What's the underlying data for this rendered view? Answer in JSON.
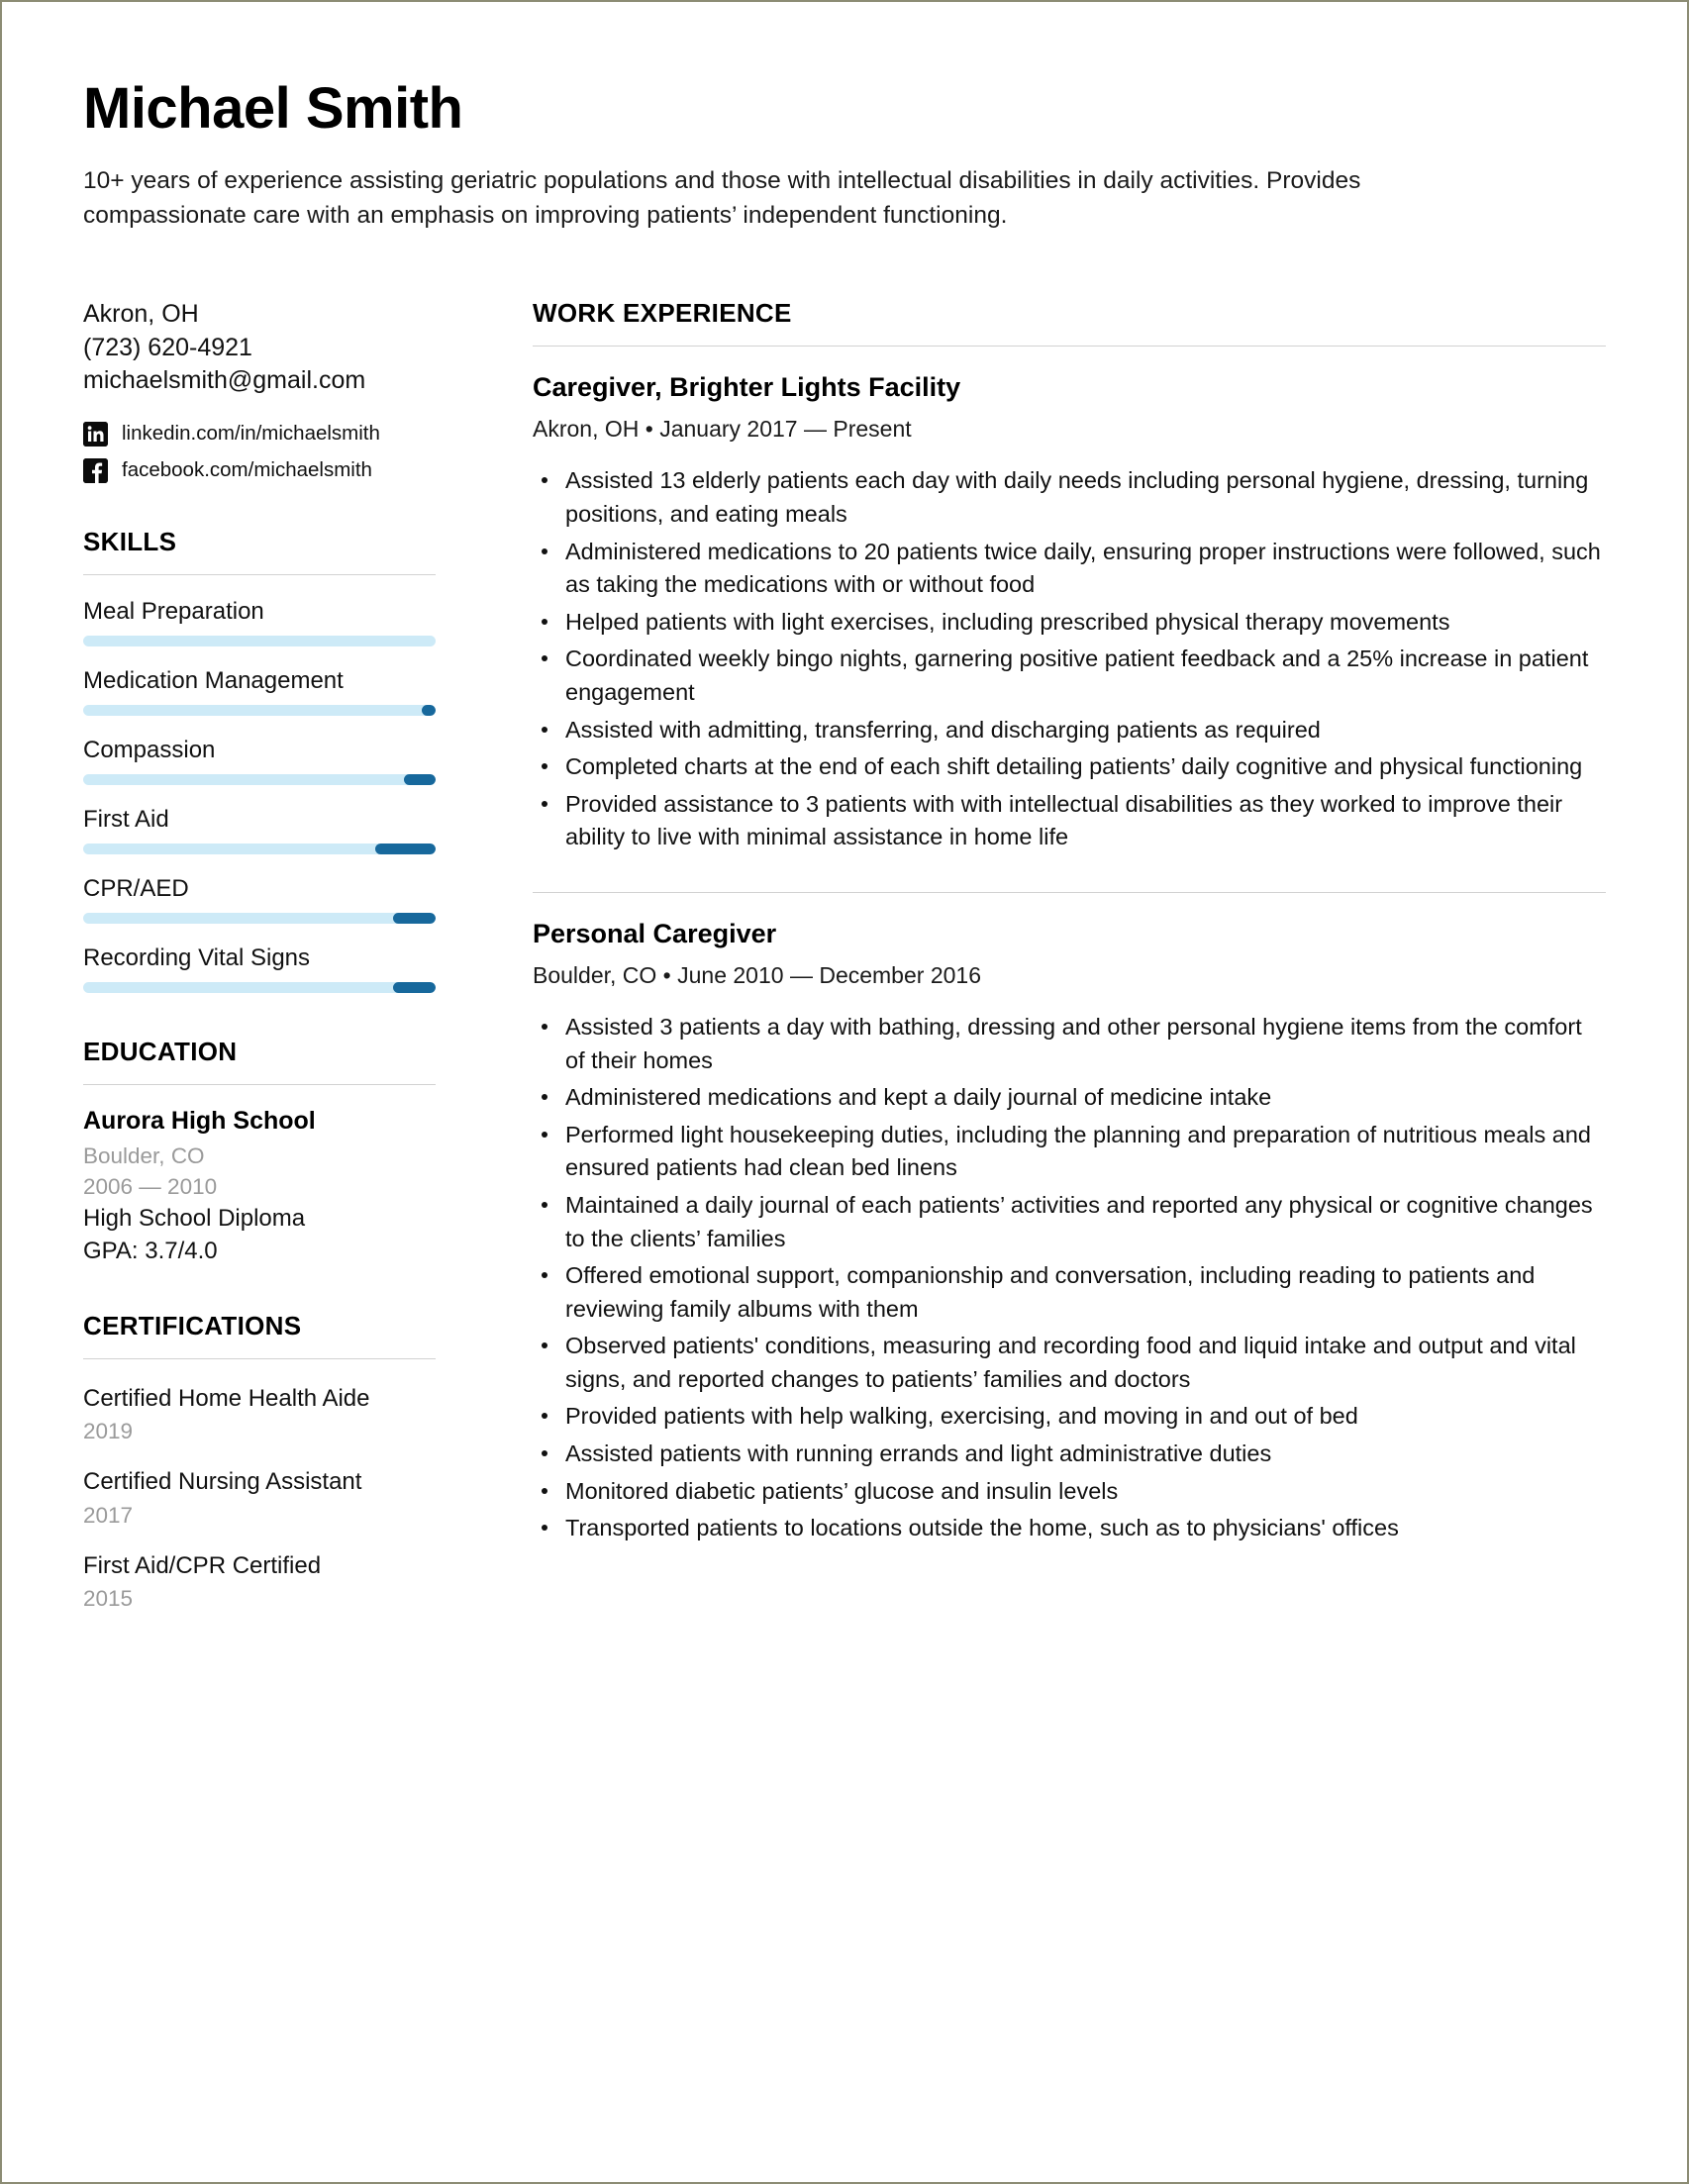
{
  "header": {
    "name": "Michael Smith",
    "summary": "10+ years of experience assisting geriatric populations and those with intellectual disabilities in daily activities. Provides compassionate care with an emphasis on improving patients’ independent functioning."
  },
  "contact": {
    "location": "Akron, OH",
    "phone": "(723) 620-4921",
    "email": "michaelsmith@gmail.com",
    "social": [
      {
        "icon": "linkedin-icon",
        "text": "linkedin.com/in/michaelsmith"
      },
      {
        "icon": "facebook-icon",
        "text": "facebook.com/michaelsmith"
      }
    ]
  },
  "skills": {
    "heading": "SKILLS",
    "items": [
      {
        "label": "Meal Preparation",
        "level": 0
      },
      {
        "label": "Medication Management",
        "level": 4
      },
      {
        "label": "Compassion",
        "level": 9
      },
      {
        "label": "First Aid",
        "level": 17
      },
      {
        "label": "CPR/AED",
        "level": 12
      },
      {
        "label": "Recording Vital Signs",
        "level": 12
      }
    ]
  },
  "education": {
    "heading": "EDUCATION",
    "school": "Aurora High School",
    "location": "Boulder, CO",
    "dates": "2006 — 2010",
    "degree": "High School Diploma",
    "gpa": "GPA: 3.7/4.0"
  },
  "certifications": {
    "heading": "CERTIFICATIONS",
    "items": [
      {
        "name": "Certified Home Health Aide",
        "year": "2019"
      },
      {
        "name": "Certified Nursing Assistant",
        "year": "2017"
      },
      {
        "name": "First Aid/CPR Certified",
        "year": "2015"
      }
    ]
  },
  "work": {
    "heading": "WORK EXPERIENCE",
    "jobs": [
      {
        "title": "Caregiver, Brighter Lights Facility",
        "meta": "Akron, OH • January 2017 — Present",
        "bullets": [
          "Assisted 13 elderly patients each day with daily needs including personal hygiene, dressing, turning positions, and eating meals",
          "Administered medications to 20 patients twice daily, ensuring proper instructions were followed, such as taking the medications with or without food",
          "Helped patients with light exercises, including prescribed physical therapy movements",
          "Coordinated weekly bingo nights, garnering positive patient feedback and a 25% increase in patient engagement",
          "Assisted with admitting, transferring, and discharging patients as required",
          "Completed charts at the end of each shift detailing patients’ daily cognitive and physical functioning",
          "Provided assistance to 3 patients with with intellectual disabilities as they worked to improve their ability to live with minimal assistance in home life"
        ]
      },
      {
        "title": "Personal Caregiver",
        "meta": "Boulder, CO • June 2010 — December 2016",
        "bullets": [
          "Assisted 3 patients a day with bathing, dressing and other personal hygiene items from the comfort of their homes",
          "Administered medications and kept a daily journal of medicine intake",
          "Performed light housekeeping duties, including the planning and preparation of nutritious meals and ensured patients had clean bed linens",
          "Maintained a daily journal of each patients’ activities and reported any physical or cognitive changes to the clients’ families",
          "Offered emotional support, companionship and conversation, including reading to patients and reviewing family albums with them",
          "Observed patients' conditions, measuring and recording food and liquid intake and output and vital signs, and reported changes to patients’ families and doctors",
          "Provided patients with help walking, exercising, and moving in and out of bed",
          "Assisted patients with running errands and light administrative duties",
          "Monitored diabetic patients’ glucose and insulin levels",
          "Transported patients to locations outside the home, such as to physicians' offices"
        ]
      }
    ]
  },
  "colors": {
    "skill_track": "#cdeaf7",
    "skill_fill": "#17689c",
    "rule": "#d2d2d2",
    "muted_text": "#9a9a9a",
    "page_border": "#8c8c74"
  }
}
